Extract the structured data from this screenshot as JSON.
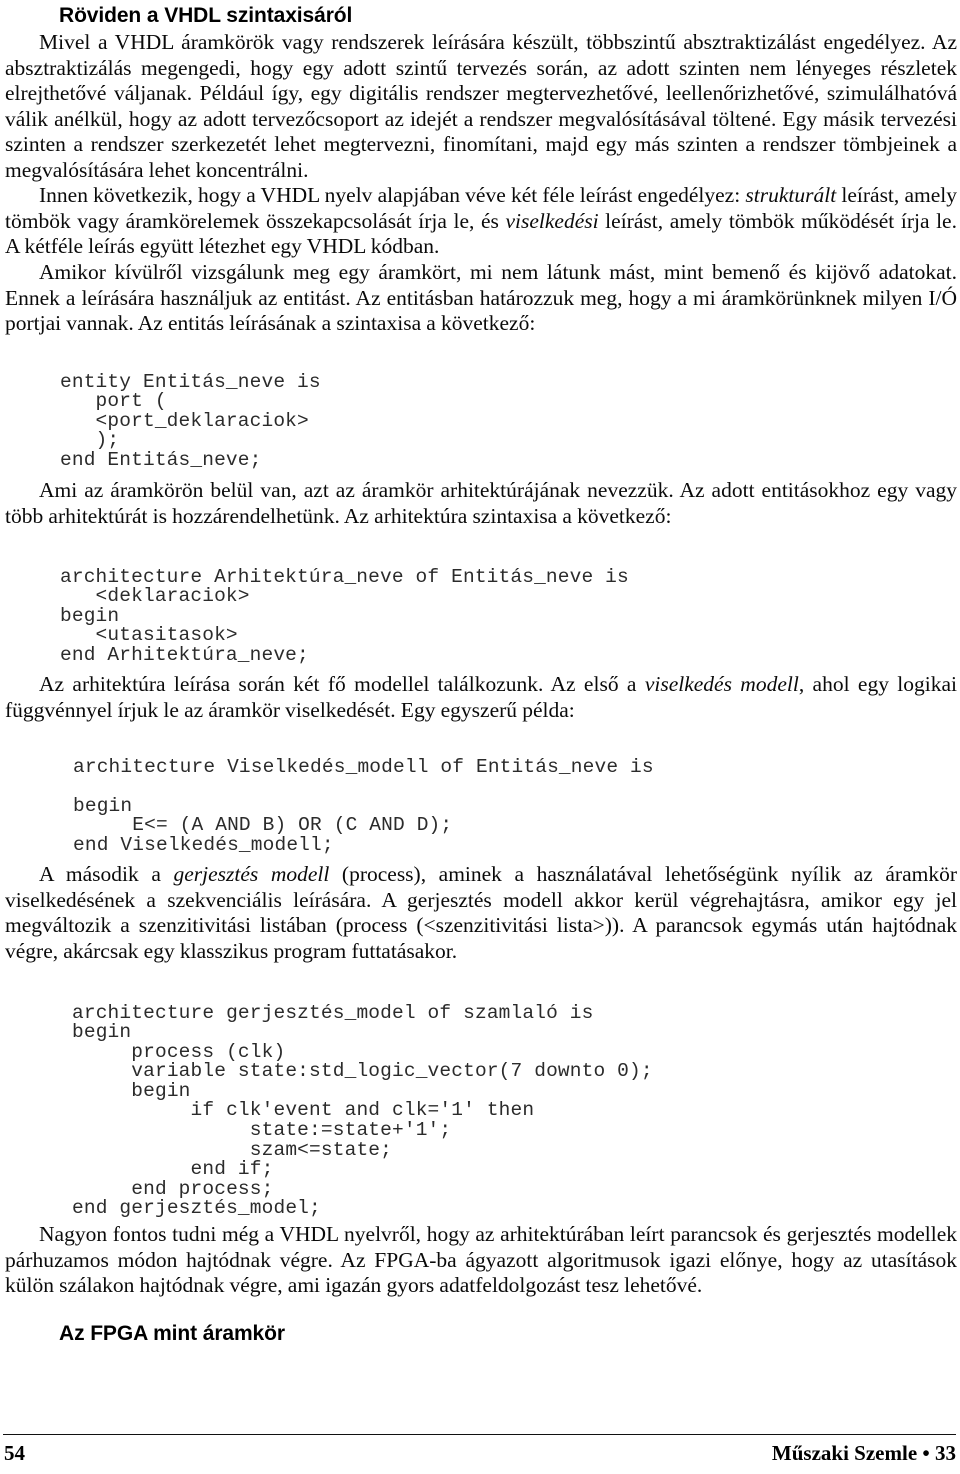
{
  "headings": {
    "main": "Röviden a VHDL szintaxisáról",
    "fpga": "Az FPGA mint áramkör"
  },
  "paragraphs": {
    "p1_a": "Mivel a VHDL áramkörök vagy rendszerek leírására készült, többszintű absztraktizálást engedélyez. Az absztraktizálás megengedi, hogy egy adott szintű tervezés során, az adott szinten nem lényeges részletek elrejthetővé váljanak. Például így, egy digitális rendszer megtervezhetővé, leellenőrizhetővé, szimulálhatóvá válik anélkül, hogy az adott tervezőcsoport az idejét a rendszer megvalósításával töltené. Egy másik tervezési szinten a rendszer szerkezetét lehet megtervezni, finomítani, majd egy más szinten a rendszer tömbjeinek a megvalósítására lehet koncentrálni.",
    "p2_pre": "Innen következik, hogy a VHDL nyelv alapjában véve két féle leírást engedélyez: ",
    "p2_em1": "strukturált",
    "p2_mid": " leírást, amely tömbök vagy áramkörelemek összekapcsolását írja le, és ",
    "p2_em2": "viselkedési",
    "p2_post": " leírást, amely tömbök működését írja le. A kétféle leírás együtt létezhet egy VHDL kódban.",
    "p3": "Amikor kívülről vizsgálunk meg egy áramkört, mi nem látunk mást, mint bemenő és kijövő adatokat. Ennek a leírására használjuk az entitást. Az entitásban határozzuk meg, hogy a mi áramkörünknek milyen I/Ó portjai vannak. Az entitás leírásának a szintaxisa a következő:",
    "p4": "Ami az áramkörön belül van, azt az áramkör arhitektúrájának nevezzük. Az adott entitásokhoz egy vagy több arhitektúrát is hozzárendelhetünk. Az arhitektúra szintaxisa a következő:",
    "p5_pre": "Az arhitektúra leírása során két fő modellel találkozunk. Az első a ",
    "p5_em": "viselkedés modell",
    "p5_post": ", ahol egy logikai függvénnyel írjuk le az áramkör viselkedését. Egy egyszerű példa:",
    "p6_pre": "A második a ",
    "p6_em": "gerjesztés modell",
    "p6_post": " (process), aminek a használatával lehetőségünk nyílik az áramkör viselkedésének a szekvenciális leírására. A gerjesztés modell akkor kerül végrehajtásra, amikor egy jel megváltozik a szenzitivitási listában (process (<szenzitivitási lista>)). A parancsok egymás után hajtódnak végre, akárcsak egy klasszikus program futtatásakor.",
    "p7": "Nagyon fontos tudni még a VHDL nyelvről, hogy az arhitektúrában leírt parancsok és gerjesztés modellek párhuzamos módon hajtódnak végre. Az FPGA-ba ágyazott algoritmusok igazi előnye, hogy az utasítások külön szálakon hajtódnak végre, ami igazán gyors adatfeldolgozást tesz lehetővé."
  },
  "code_blocks": {
    "entity": "entity Entitás_neve is\n   port (\n   <port_deklaraciok>\n   );\nend Entitás_neve;",
    "architecture": "architecture Arhitektúra_neve of Entitás_neve is\n   <deklaraciok>\nbegin\n   <utasitasok>\nend Arhitektúra_neve;",
    "behavior": "architecture Viselkedés_modell of Entitás_neve is\n\nbegin\n     E<= (A AND B) OR (C AND D);\nend Viselkedés_modell;",
    "process": "architecture gerjesztés_model of szamlaló is\nbegin\n     process (clk)\n     variable state:std_logic_vector(7 downto 0);\n     begin\n          if clk'event and clk='1' then\n               state:=state+'1';\n               szam<=state;\n          end if;\n     end process;\nend gerjesztés_model;"
  },
  "footer": {
    "page_number": "54",
    "journal": "Műszaki Szemle • 33"
  },
  "colors": {
    "text": "#0a0a0a",
    "code": "#2b2b2b",
    "rule": "#111111",
    "background": "#ffffff"
  }
}
